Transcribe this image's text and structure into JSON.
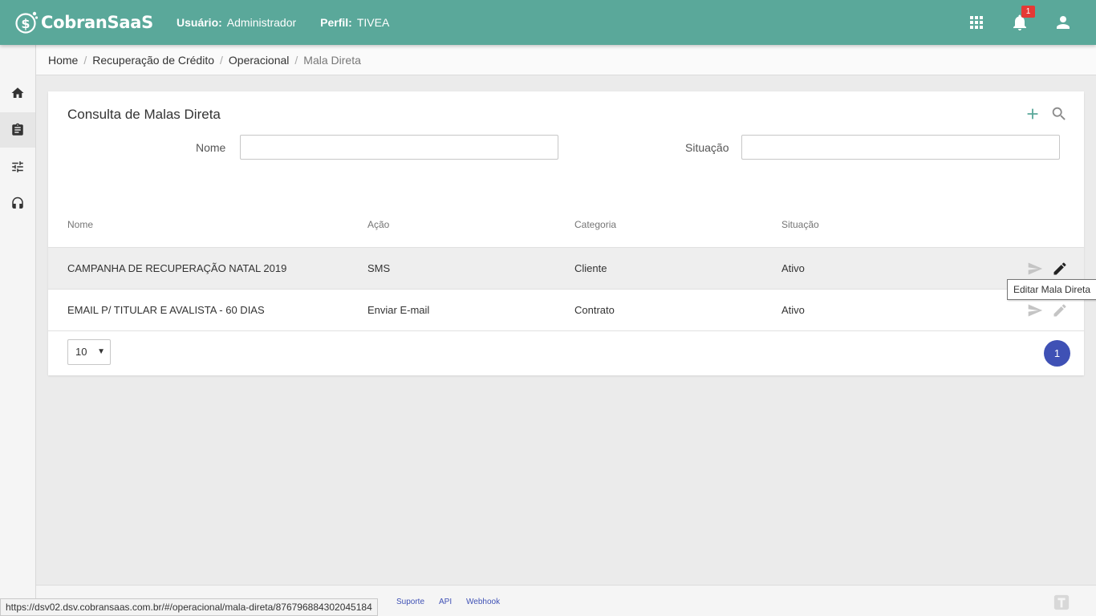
{
  "app": {
    "name": "CobranSaaS",
    "user_label": "Usuário:",
    "user_value": "Administrador",
    "profile_label": "Perfil:",
    "profile_value": "TIVEA",
    "notification_count": "1",
    "brand_color": "#5aa89a"
  },
  "breadcrumb": [
    "Home",
    "Recuperação de Crédito",
    "Operacional",
    "Mala Direta"
  ],
  "page": {
    "title": "Consulta de Malas Direta",
    "filters": {
      "nome_label": "Nome",
      "nome_value": "",
      "situacao_label": "Situação",
      "situacao_value": ""
    }
  },
  "table": {
    "headers": [
      "Nome",
      "Ação",
      "Categoria",
      "Situação"
    ],
    "rows": [
      [
        "CAMPANHA DE RECUPERAÇÃO NATAL 2019",
        "SMS",
        "Cliente",
        "Ativo"
      ],
      [
        "EMAIL P/ TITULAR E AVALISTA - 60 DIAS",
        "Enviar E-mail",
        "Contrato",
        "Ativo"
      ]
    ]
  },
  "pagination": {
    "page_size": "10",
    "current_page": "1",
    "accent_color": "#3f51b5"
  },
  "tooltip": "Editar Mala Direta",
  "footer": {
    "links": [
      "Suporte",
      "API",
      "Webhook"
    ]
  },
  "statusbar": {
    "url": "https://dsv02.dsv.cobransaas.com.br/#/operacional/mala-direta/876796884302045184"
  },
  "icons": [
    "apps-icon",
    "bell-icon",
    "account-icon",
    "home-icon",
    "clipboard-icon",
    "sliders-icon",
    "headset-icon",
    "plus-icon",
    "search-icon",
    "send-icon",
    "pencil-icon"
  ]
}
